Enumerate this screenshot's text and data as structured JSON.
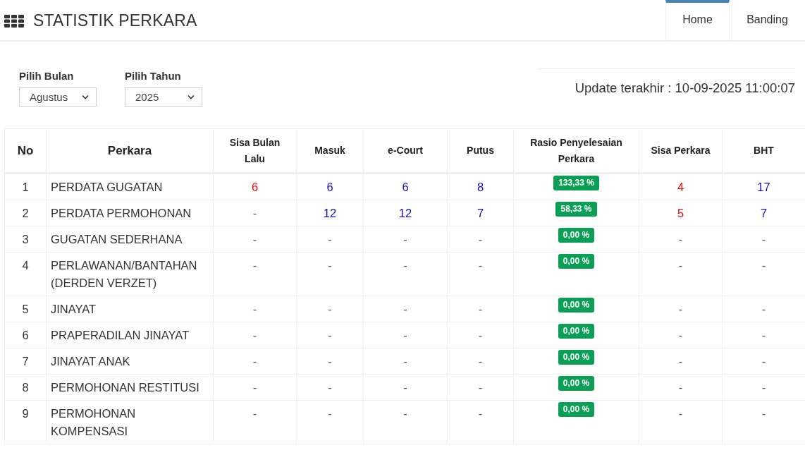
{
  "header": {
    "title": "STATISTIK PERKARA"
  },
  "tabs": [
    {
      "label": "Home",
      "selected": true
    },
    {
      "label": "Banding",
      "selected": false
    }
  ],
  "filters": [
    {
      "label": "Pilih Bulan",
      "value": "Agustus"
    },
    {
      "label": "Pilih Tahun",
      "value": "2025"
    }
  ],
  "update_text": "Update terakhir : 10-09-2025 11:00:07",
  "table": {
    "columns": [
      "No",
      "Perkara",
      "Sisa Bulan Lalu",
      "Masuk",
      "e-Court",
      "Putus",
      "Rasio Penyelesaian Perkara",
      "Sisa Perkara",
      "BHT"
    ],
    "rows": [
      {
        "cells": [
          "1",
          "PERDATA GUGATAN",
          {
            "text": "6",
            "color": "#e01010"
          },
          {
            "text": "6",
            "color": "#1010c0"
          },
          {
            "text": "6",
            "color": "#1010c0"
          },
          {
            "text": "8",
            "color": "#1010c0"
          },
          {
            "text": "133,33 %",
            "kind": "badge"
          },
          {
            "text": "4",
            "color": "#e01010"
          },
          {
            "text": "17",
            "color": "#1010c0"
          }
        ]
      },
      {
        "cells": [
          "2",
          "PERDATA PERMOHONAN",
          "-",
          {
            "text": "12",
            "color": "#1010c0"
          },
          {
            "text": "12",
            "color": "#1010c0"
          },
          {
            "text": "7",
            "color": "#1010c0"
          },
          {
            "text": "58,33 %",
            "kind": "badge"
          },
          {
            "text": "5",
            "color": "#e01010"
          },
          {
            "text": "7",
            "color": "#1010c0"
          }
        ]
      },
      {
        "cells": [
          "3",
          "GUGATAN SEDERHANA",
          "-",
          "-",
          "-",
          "-",
          {
            "text": "0,00 %",
            "kind": "badge"
          },
          "-",
          "-"
        ]
      },
      {
        "cells": [
          "4",
          "PERLAWANAN/BANTAHAN (DERDEN VERZET)",
          "-",
          "-",
          "-",
          "-",
          {
            "text": "0,00 %",
            "kind": "badge"
          },
          "-",
          "-"
        ]
      },
      {
        "cells": [
          "5",
          "JINAYAT",
          "-",
          "-",
          "-",
          "-",
          {
            "text": "0,00 %",
            "kind": "badge"
          },
          "-",
          "-"
        ]
      },
      {
        "cells": [
          "6",
          "PRAPERADILAN JINAYAT",
          "-",
          "-",
          "-",
          "-",
          {
            "text": "0,00 %",
            "kind": "badge"
          },
          "-",
          "-"
        ]
      },
      {
        "cells": [
          "7",
          "JINAYAT ANAK",
          "-",
          "-",
          "-",
          "-",
          {
            "text": "0,00 %",
            "kind": "badge"
          },
          "-",
          "-"
        ]
      },
      {
        "cells": [
          "8",
          "PERMOHONAN RESTITUSI",
          "-",
          "-",
          "-",
          "-",
          {
            "text": "0,00 %",
            "kind": "badge"
          },
          "-",
          "-"
        ]
      },
      {
        "cells": [
          "9",
          "PERMOHONAN KOMPENSASI",
          "-",
          "-",
          "-",
          "-",
          {
            "text": "0,00 %",
            "kind": "badge"
          },
          "-",
          "-"
        ]
      }
    ]
  }
}
